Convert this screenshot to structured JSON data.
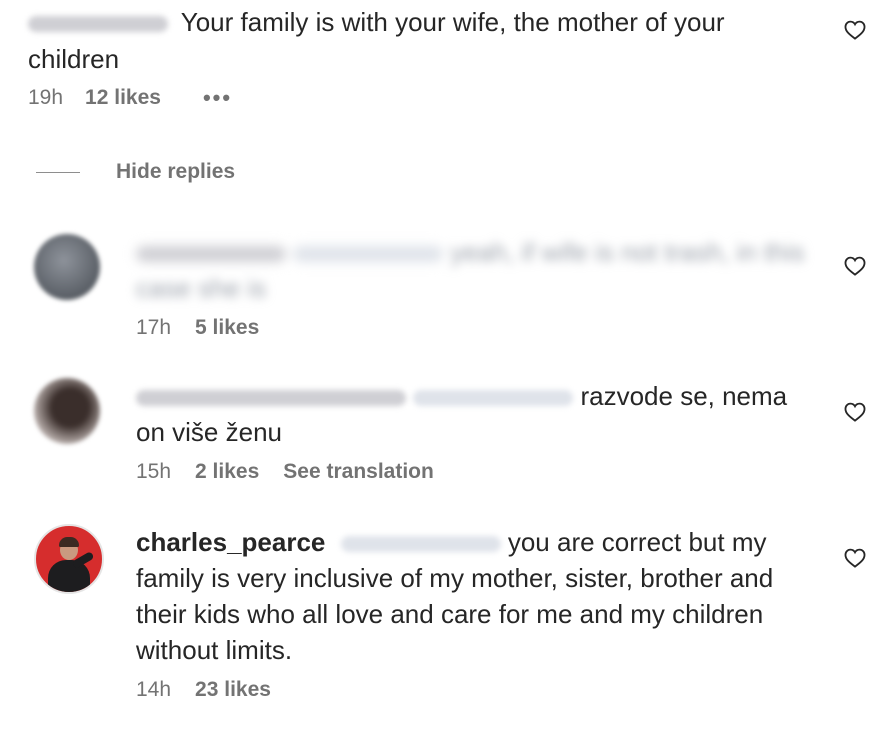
{
  "top_comment": {
    "text": "Your family is with your wife, the mother of your children",
    "time": "19h",
    "likes": "12 likes",
    "more_icon": "more-horizontal-icon"
  },
  "hide_replies": {
    "label": "Hide replies"
  },
  "replies": [
    {
      "text": "yeah, if wife is not trash, in this case she is",
      "time": "17h",
      "likes": "5 likes"
    },
    {
      "text": "razvode se, nema on više ženu",
      "time": "15h",
      "likes": "2 likes",
      "see_translation": "See translation"
    },
    {
      "username": "charles_pearce",
      "text": "you are correct but my family is very inclusive of my mother, sister, brother and their kids who all love and care for me and my children without limits.",
      "time": "14h",
      "likes": "23 likes"
    }
  ],
  "icons": {
    "like": "heart-outline-icon"
  },
  "colors": {
    "text": "#262626",
    "secondary": "#737373",
    "avatar_red": "#d62d2d"
  }
}
